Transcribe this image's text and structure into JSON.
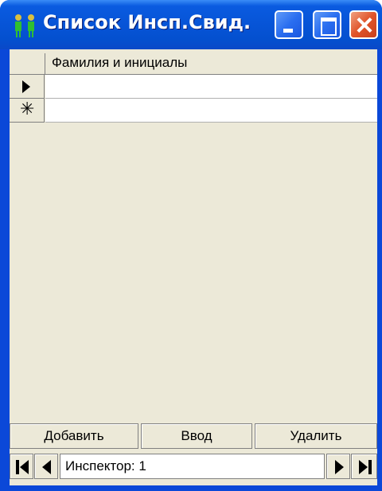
{
  "window": {
    "title": "Список Инсп.Свид.",
    "icon": "people-icon"
  },
  "grid": {
    "columns": [
      "Фамилия и инициалы"
    ],
    "rows": [
      {
        "indicator": "current-row",
        "cells": [
          ""
        ]
      },
      {
        "indicator": "new-row",
        "cells": [
          ""
        ]
      }
    ],
    "new_row_glyph": "✳"
  },
  "buttons": {
    "add_label": "Добавить",
    "enter_label": "Ввод",
    "delete_label": "Удалить"
  },
  "navigator": {
    "record_text": "Инспектор: 1"
  },
  "colors": {
    "titlebar": "#0755d8",
    "face": "#ece9d8",
    "close": "#e0542a"
  }
}
